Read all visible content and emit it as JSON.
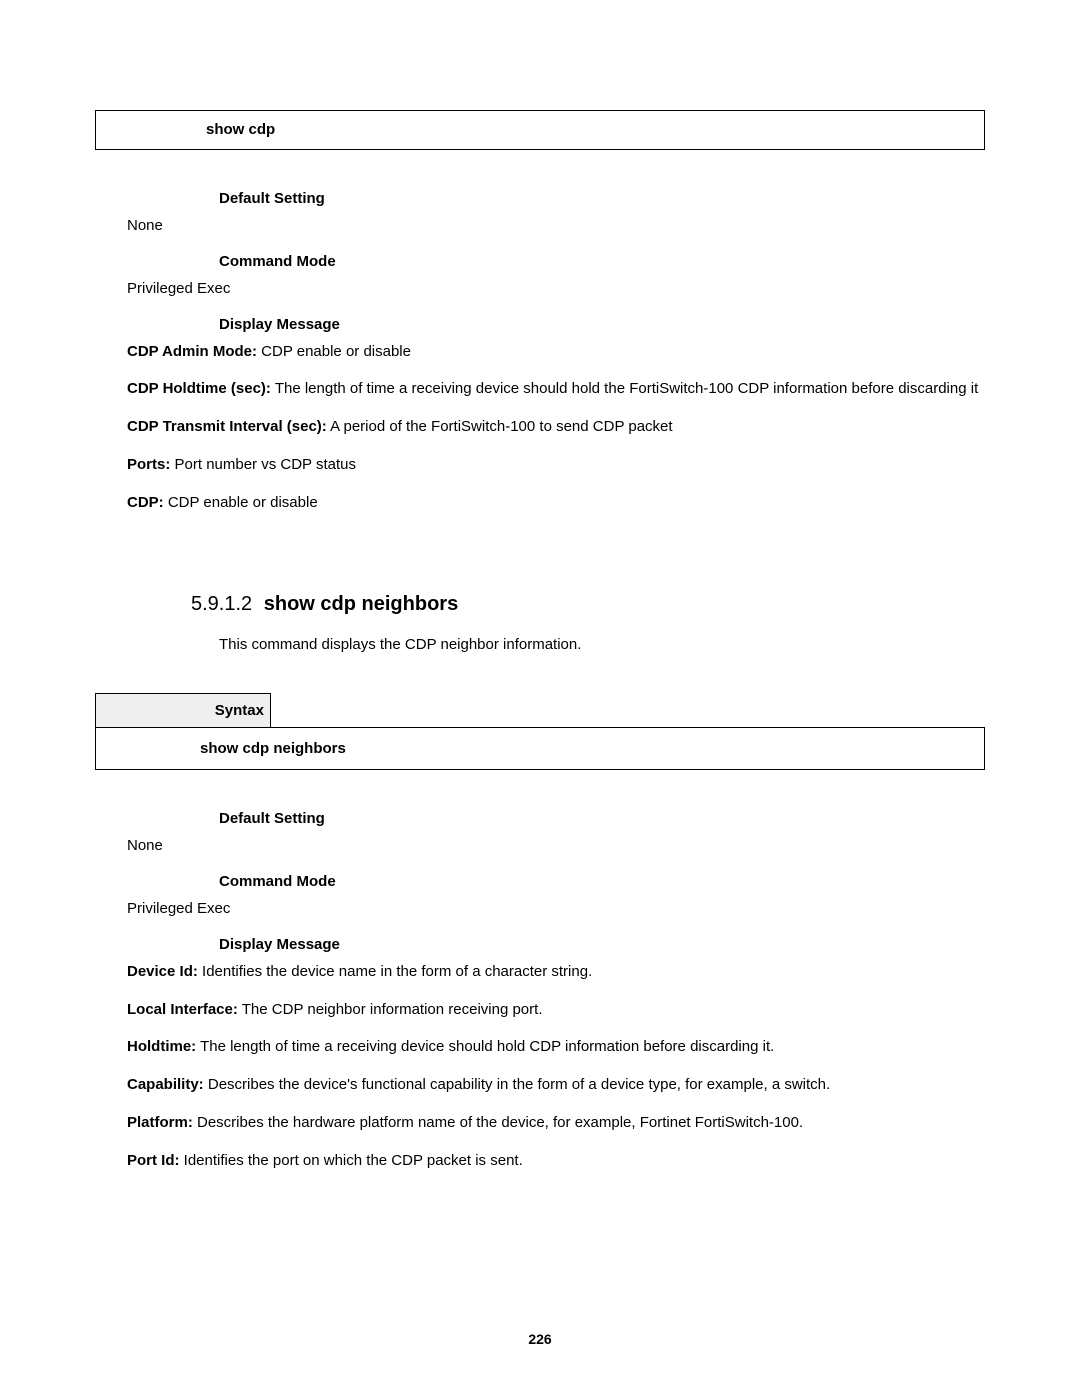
{
  "box1": {
    "command": "show cdp"
  },
  "sec1": {
    "defaultSettingLabel": "Default Setting",
    "defaultSettingValue": "None",
    "commandModeLabel": "Command Mode",
    "commandModeValue": "Privileged Exec",
    "displayMessageLabel": "Display Message",
    "items": [
      {
        "term": "CDP Admin Mode:",
        "desc": " CDP enable or disable"
      },
      {
        "term": "CDP Holdtime (sec):",
        "desc": " The length of time a receiving device should hold the FortiSwitch-100 CDP information before discarding it"
      },
      {
        "term": "CDP Transmit Interval (sec):",
        "desc": " A period of the FortiSwitch-100 to send CDP packet"
      },
      {
        "term": "Ports:",
        "desc": " Port number vs CDP status"
      },
      {
        "term": "CDP:",
        "desc": " CDP enable or disable"
      }
    ]
  },
  "sec2": {
    "number": "5.9.1.2",
    "title": "show cdp neighbors",
    "intro": "This command displays the CDP neighbor information.",
    "syntaxLabel": "Syntax",
    "command": "show cdp neighbors",
    "defaultSettingLabel": "Default Setting",
    "defaultSettingValue": "None",
    "commandModeLabel": "Command Mode",
    "commandModeValue": "Privileged Exec",
    "displayMessageLabel": "Display Message",
    "items": [
      {
        "term": "Device Id:",
        "desc": " Identifies the device name in the form of a character string."
      },
      {
        "term": "Local Interface:",
        "desc": " The CDP neighbor information receiving port."
      },
      {
        "term": "Holdtime:",
        "desc": " The length of time a receiving device should hold CDP information before discarding it."
      },
      {
        "term": "Capability:",
        "desc": " Describes the device's functional capability in the form of a device type, for example, a switch."
      },
      {
        "term": "Platform:",
        "desc": " Describes the hardware platform name of the device, for example, Fortinet FortiSwitch-100."
      },
      {
        "term": "Port Id:",
        "desc": " Identifies the port on which the CDP packet is sent."
      }
    ]
  },
  "pageNumber": "226"
}
